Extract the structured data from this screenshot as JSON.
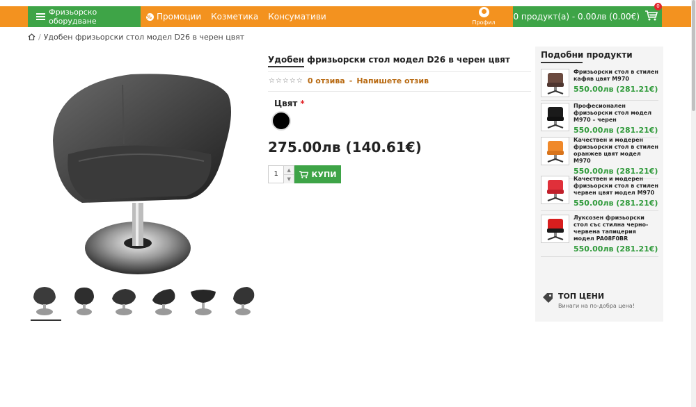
{
  "header": {
    "category_button": "Фризьорско оборудване",
    "nav": [
      "Промоции",
      "Козметика",
      "Консумативи"
    ],
    "profile_label": "Профил",
    "cart_text": "0 продукт(а) - 0.00лв (0.00€)",
    "cart_badge": "0",
    "colors": {
      "orange": "#f3921f",
      "green": "#3ea447"
    }
  },
  "breadcrumb": {
    "current": "Удобен фризьорски стол модел D26 в черен цвят"
  },
  "product": {
    "title": "Удобен фризьорски стол модел D26 в черен цвят",
    "stars": "☆☆☆☆☆",
    "reviews_link": "0 отзива",
    "separator": "-",
    "write_review_link": "Напишете отзив",
    "color_label": "Цвят",
    "required_mark": "*",
    "selected_color": "#000000",
    "price": "275.00лв (140.61€)",
    "quantity": "1",
    "buy_button": "КУПИ"
  },
  "sidebar": {
    "title": "Подобни продукти",
    "items": [
      {
        "name": "Фризьорски стол в стилен кафяв цвят M970",
        "price": "550.00лв (281.21€)",
        "color": "#6b4a3f"
      },
      {
        "name": "Професионален фризьорски стол модел M970 – черен",
        "price": "550.00лв (281.21€)",
        "color": "#1a1a1a"
      },
      {
        "name": "Качествен и модерен фризьорски стол в стилен оранжев цвят модел M970",
        "price": "550.00лв (281.21€)",
        "color": "#f0892a"
      },
      {
        "name": "Качествен и модерен фризьорски стол в стилен червен цвят модел M970",
        "price": "550.00лв (281.21€)",
        "color": "#e0303a"
      },
      {
        "name": "Луксозен фризьорски стол със стилна черно-червена тапицерия модел PA08F0BR",
        "price": "550.00лв (281.21€)",
        "color": "#d81e1e"
      }
    ],
    "top_prices_title": "ТОП ЦЕНИ",
    "top_prices_sub": "Винаги на по-добра цена!"
  }
}
